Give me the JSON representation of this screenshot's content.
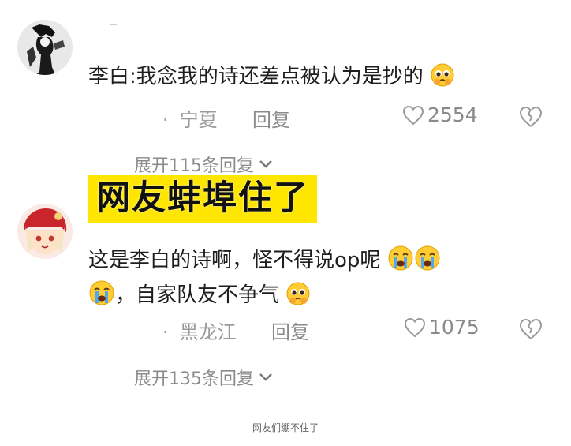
{
  "comments": [
    {
      "text": "李白:我念我的诗还差点被认为是抄的",
      "region": "宁夏",
      "reply_label": "回复",
      "likes": "2554",
      "expand_label": "展开115条回复"
    },
    {
      "text_line1": "这是李白的诗啊，怪不得说op呢",
      "text_line2": "，自家队友不争气",
      "region": "黑龙江",
      "reply_label": "回复",
      "likes": "1075",
      "expand_label": "展开135条回复"
    }
  ],
  "overlay_text": "网友蚌埠住了",
  "caption": "网友们绷不住了",
  "colors": {
    "overlay_bg": "#ffe600",
    "muted": "#8a8a8a"
  },
  "icons": [
    "heart-outline-icon",
    "broken-heart-icon",
    "chevron-down-icon",
    "pleading-face-emoji",
    "crying-face-emoji"
  ]
}
